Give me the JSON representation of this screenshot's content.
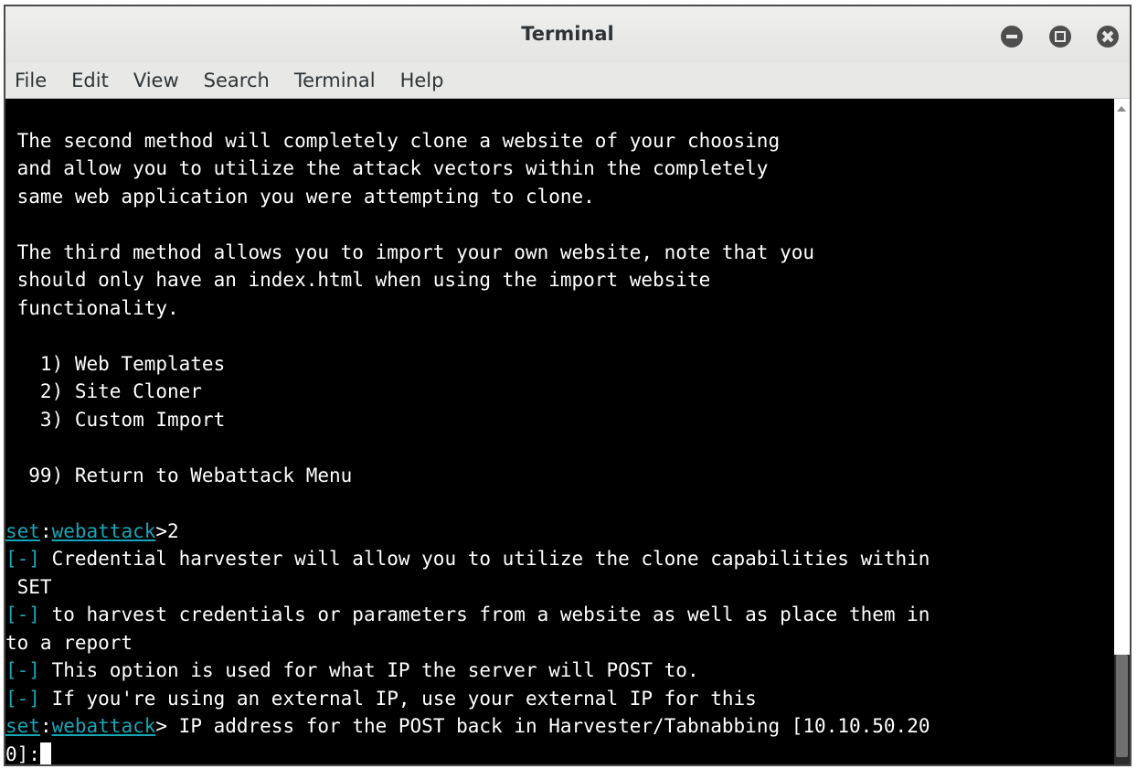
{
  "window": {
    "title": "Terminal"
  },
  "menu": [
    "File",
    "Edit",
    "View",
    "Search",
    "Terminal",
    "Help"
  ],
  "prompt": {
    "set": "set",
    "sep": ":",
    "module": "webattack"
  },
  "terminal_lines": [
    {
      "text": ""
    },
    {
      "text": " The second method will completely clone a website of your choosing"
    },
    {
      "text": " and allow you to utilize the attack vectors within the completely"
    },
    {
      "text": " same web application you were attempting to clone."
    },
    {
      "text": ""
    },
    {
      "text": " The third method allows you to import your own website, note that you"
    },
    {
      "text": " should only have an index.html when using the import website"
    },
    {
      "text": " functionality."
    },
    {
      "text": ""
    },
    {
      "text": "   1) Web Templates"
    },
    {
      "text": "   2) Site Cloner"
    },
    {
      "text": "   3) Custom Import"
    },
    {
      "text": ""
    },
    {
      "text": "  99) Return to Webattack Menu"
    },
    {
      "text": ""
    },
    {
      "prompt": true,
      "text": ">2"
    },
    {
      "marker": "[-]",
      "text": " Credential harvester will allow you to utilize the clone capabilities within"
    },
    {
      "text": " SET"
    },
    {
      "marker": "[-]",
      "text": " to harvest credentials or parameters from a website as well as place them in"
    },
    {
      "text": "to a report"
    },
    {
      "marker": "[-]",
      "text": " This option is used for what IP the server will POST to."
    },
    {
      "marker": "[-]",
      "text": " If you're using an external IP, use your external IP for this"
    },
    {
      "prompt": true,
      "text": "> IP address for the POST back in Harvester/Tabnabbing [10.10.50.20"
    },
    {
      "text": "0]:",
      "cursor": true
    }
  ]
}
